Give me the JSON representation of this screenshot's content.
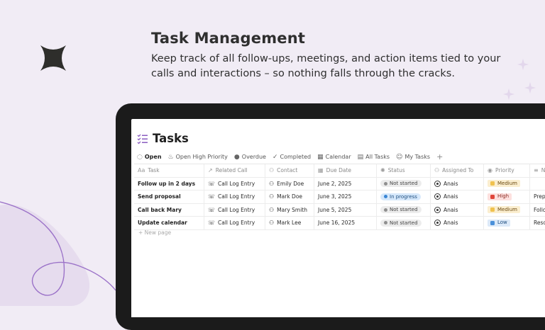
{
  "hero": {
    "title": "Task Management",
    "subtitle": "Keep track of all follow-ups, meetings, and action items tied to your calls and interactions – so nothing falls through the cracks."
  },
  "database": {
    "title": "Tasks",
    "icon": "checklist-icon"
  },
  "views": [
    {
      "label": "Open",
      "icon": "circle-icon"
    },
    {
      "label": "Open High Priority",
      "icon": "fire-icon"
    },
    {
      "label": "Overdue",
      "icon": "alert-icon"
    },
    {
      "label": "Completed",
      "icon": "check-icon"
    },
    {
      "label": "Calendar",
      "icon": "calendar-icon"
    },
    {
      "label": "All Tasks",
      "icon": "table-icon"
    },
    {
      "label": "My Tasks",
      "icon": "person-icon"
    },
    {
      "label": "+",
      "icon": "plus-icon"
    }
  ],
  "columns": [
    "Task",
    "Related Call",
    "Contact",
    "Due Date",
    "Status",
    "Assigned To",
    "Priority",
    "N"
  ],
  "rows": [
    {
      "task": "Follow up in 2 days",
      "call": "Call Log Entry",
      "contact": "Emily Doe",
      "due": "June 2, 2025",
      "status": "Not started",
      "assignee": "Anais",
      "priority": "Medium",
      "notes": ""
    },
    {
      "task": "Send proposal",
      "call": "Call Log Entry",
      "contact": "Mark Doe",
      "due": "June 3, 2025",
      "status": "In progress",
      "assignee": "Anais",
      "priority": "High",
      "notes": "Prepa"
    },
    {
      "task": "Call back Mary",
      "call": "Call Log Entry",
      "contact": "Mary Smith",
      "due": "June 5, 2025",
      "status": "Not started",
      "assignee": "Anais",
      "priority": "Medium",
      "notes": "Follo"
    },
    {
      "task": "Update calendar",
      "call": "Call Log Entry",
      "contact": "Mark Lee",
      "due": "June 16, 2025",
      "status": "Not started",
      "assignee": "Anais",
      "priority": "Low",
      "notes": "Resch"
    }
  ],
  "new_page_label": "+ New page",
  "colors": {
    "background": "#f1ecf5",
    "accent_purple": "#9b72c8",
    "status_not_started": "#ececec",
    "status_in_progress": "#d6e8fb",
    "priority_medium": "#fbeecf",
    "priority_high": "#fde0de",
    "priority_low": "#dce9f8"
  }
}
